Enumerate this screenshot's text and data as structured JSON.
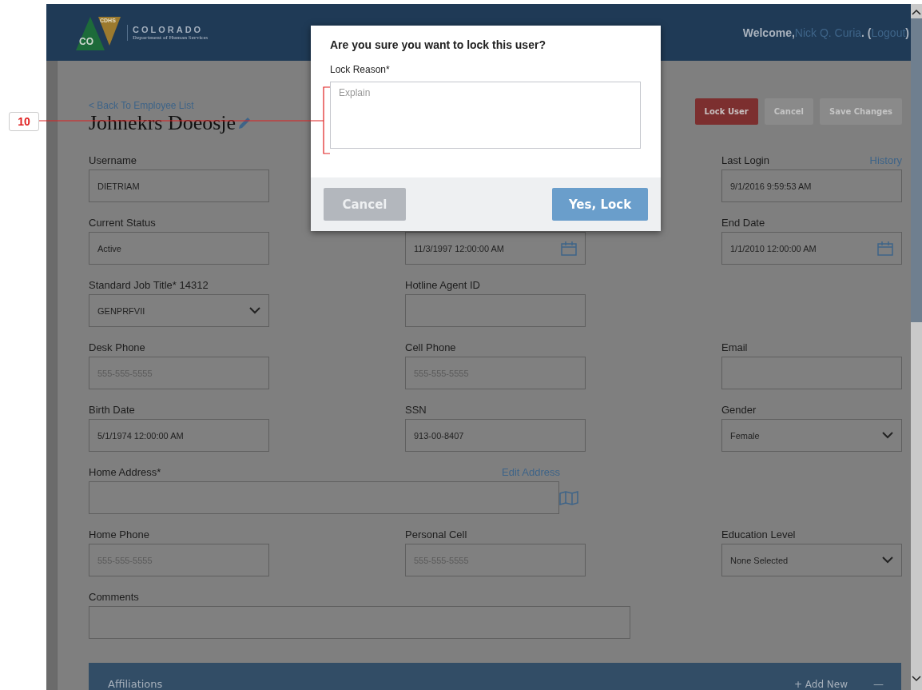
{
  "header": {
    "org_name": "COLORADO",
    "org_sub": "Department of Human Services",
    "badge": "CDHS",
    "logo_letters": "CO",
    "welcome": "Welcome,",
    "user": "Nick Q. Curia",
    "after_user": ". (",
    "logout": "Logout",
    "close_paren": ")"
  },
  "back_link": "< Back To Employee List",
  "employee_name": "Johnekrs Doeosje",
  "actions": [
    {
      "label": "Lock User",
      "kind": "danger",
      "disabled": false
    },
    {
      "label": "Cancel",
      "kind": "plain",
      "disabled": true
    },
    {
      "label": "Save Changes",
      "kind": "plain",
      "disabled": true
    }
  ],
  "fields": [
    {
      "kind": "text",
      "label": "Username",
      "value": "DIETRIAM"
    },
    {
      "kind": "blank"
    },
    {
      "kind": "text",
      "label": "Last Login",
      "link": "History",
      "value": "9/1/2016 9:59:53 AM"
    },
    {
      "kind": "text",
      "label": "Current Status",
      "value": "Active"
    },
    {
      "kind": "date",
      "value": "11/3/1997 12:00:00 AM"
    },
    {
      "kind": "date",
      "label": "End Date",
      "value": "1/1/2010 12:00:00 AM"
    },
    {
      "kind": "select",
      "label": "Standard Job Title* 14312",
      "value": "GENPRFVII"
    },
    {
      "kind": "text",
      "label": "Hotline Agent ID"
    },
    {
      "kind": "blank"
    },
    {
      "kind": "text",
      "label": "Desk Phone",
      "placeholder": "555-555-5555"
    },
    {
      "kind": "text",
      "label": "Cell Phone",
      "placeholder": "555-555-5555"
    },
    {
      "kind": "text",
      "label": "Email"
    },
    {
      "kind": "text",
      "label": "Birth Date",
      "value": "5/1/1974 12:00:00 AM"
    },
    {
      "kind": "text",
      "label": "SSN",
      "value": "913-00-8407"
    },
    {
      "kind": "select",
      "label": "Gender",
      "value": "Female"
    },
    {
      "kind": "address",
      "label": "Home Address*",
      "link": "Edit Address"
    },
    {
      "kind": "text",
      "label": "Home Phone",
      "placeholder": "555-555-5555"
    },
    {
      "kind": "text",
      "label": "Personal Cell",
      "placeholder": "555-555-5555"
    },
    {
      "kind": "select",
      "label": "Education Level",
      "value": "None Selected"
    },
    {
      "kind": "comments",
      "label": "Comments"
    }
  ],
  "section": {
    "title": "Affiliations",
    "add": "+ Add New",
    "collapse": "—"
  },
  "modal": {
    "title": "Are you sure you want to lock this user?",
    "label": "Lock Reason*",
    "placeholder": "Explain",
    "cancel": "Cancel",
    "confirm": "Yes, Lock"
  },
  "callout": {
    "number": "10"
  }
}
